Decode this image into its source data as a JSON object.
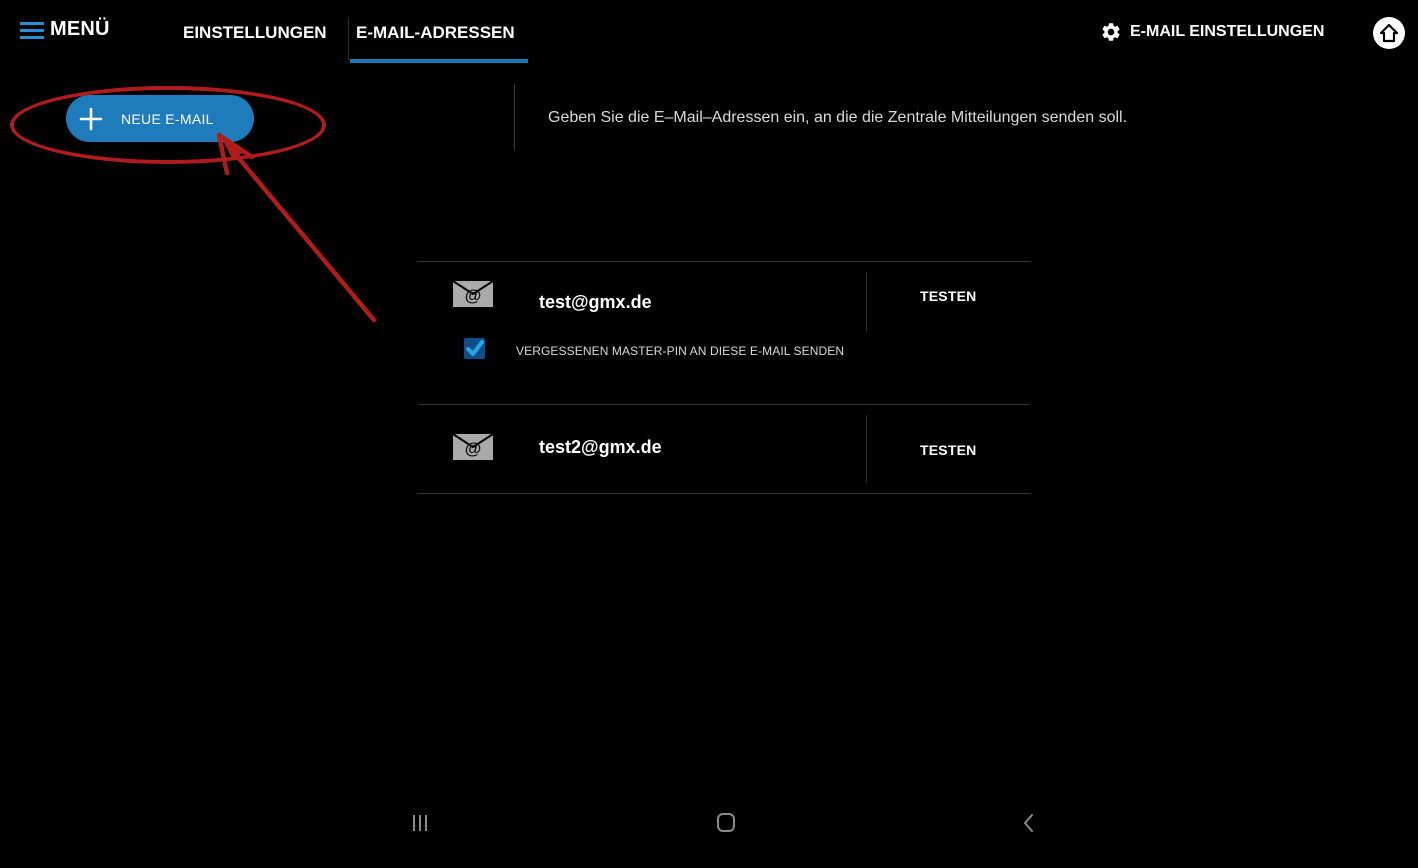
{
  "header": {
    "menu_label": "MENÜ",
    "tabs": [
      {
        "label": "EINSTELLUNGEN",
        "active": false
      },
      {
        "label": "E-MAIL-ADRESSEN",
        "active": true
      }
    ],
    "email_settings_label": "E-MAIL EINSTELLUNGEN",
    "icons": {
      "menu": "hamburger-icon",
      "email_settings": "gear-icon",
      "home": "home-icon"
    }
  },
  "toolbar": {
    "new_email_label": "NEUE E-MAIL",
    "new_email_icon": "plus-icon"
  },
  "description": "Geben Sie die E–Mail–Adressen ein, an die die Zentrale Mitteilungen senden soll.",
  "emails": [
    {
      "address": "test@gmx.de",
      "icon": "mail-at-icon",
      "test_label": "TESTEN",
      "master_pin_option": {
        "label": "VERGESSENEN MASTER-PIN AN DIESE E-MAIL SENDEN",
        "checked": true
      }
    },
    {
      "address": "test2@gmx.de",
      "icon": "mail-at-icon",
      "test_label": "TESTEN"
    }
  ],
  "annotation": {
    "color": "#b01c1c",
    "shape": "ellipse-with-arrow"
  },
  "colors": {
    "background": "#000000",
    "accent": "#1e7cbc",
    "tab_underline": "#1f78b4",
    "checkbox": "#0e4e8a",
    "checkmark": "#2aa6e8"
  },
  "navigation_bar": {
    "icons": [
      "recent-apps-icon",
      "home-circle-icon",
      "back-icon"
    ]
  }
}
